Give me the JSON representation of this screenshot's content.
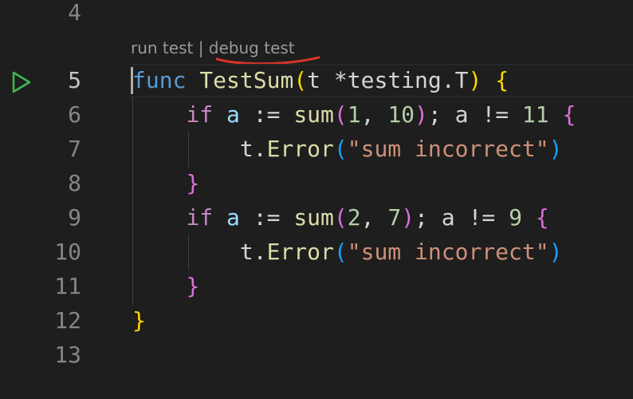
{
  "editor": {
    "codelens": {
      "run": "run test",
      "separator": " | ",
      "debug": "debug test"
    },
    "line_numbers": [
      "4",
      "5",
      "6",
      "7",
      "8",
      "9",
      "10",
      "11",
      "12",
      "13"
    ],
    "active_line": "5",
    "lines": {
      "l5": {
        "func": "func",
        "name": "TestSum",
        "open": "(",
        "params": "t *testing.T",
        "close": ")",
        "brace": "{"
      },
      "l6": {
        "if": "if",
        "a": "a",
        "assign": " := ",
        "call": "sum",
        "open": "(",
        "arg1": "1",
        "comma": ", ",
        "arg2": "10",
        "close": ")",
        "rest": "; a != ",
        "cmp": "11",
        "brace": "{"
      },
      "l7": {
        "recv": "t.",
        "method": "Error",
        "open": "(",
        "str": "\"sum incorrect\"",
        "close": ")"
      },
      "l8": {
        "brace": "}"
      },
      "l9": {
        "if": "if",
        "a": "a",
        "assign": " := ",
        "call": "sum",
        "open": "(",
        "arg1": "2",
        "comma": ", ",
        "arg2": "7",
        "close": ")",
        "rest": "; a != ",
        "cmp": "9",
        "brace": "{"
      },
      "l10": {
        "recv": "t.",
        "method": "Error",
        "open": "(",
        "str": "\"sum incorrect\"",
        "close": ")"
      },
      "l11": {
        "brace": "}"
      },
      "l12": {
        "brace": "}"
      }
    },
    "icons": {
      "run_gutter": "play-icon"
    },
    "colors": {
      "background": "#1e1e1e",
      "run_icon": "#3fb950",
      "underline_annotation": "#d8342a"
    }
  }
}
